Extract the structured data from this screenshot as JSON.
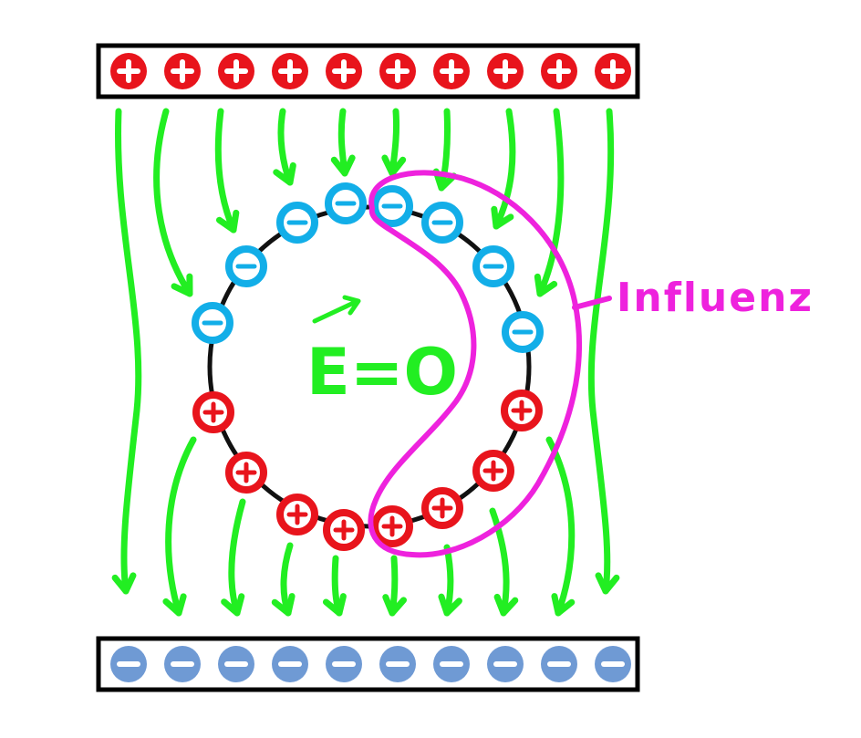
{
  "colors": {
    "field_lines": "#22ee22",
    "positive": "#e8141c",
    "negative_plate": "#6f9ad4",
    "induced_negative": "#12aee8",
    "sphere": "#111111",
    "annotation": "#ee22dd",
    "background": "#ffffff"
  },
  "top_plate": {
    "charge_sign": "positive",
    "charge_count": 10
  },
  "bottom_plate": {
    "charge_sign": "negative",
    "charge_count": 10
  },
  "sphere": {
    "induced_negative_count": 9,
    "induced_positive_count": 8
  },
  "labels": {
    "field_inside": "E=O",
    "annotation": "Influenz"
  },
  "icons": {
    "positive_charge": "plus-circle-icon",
    "negative_charge": "minus-circle-icon",
    "field_arrow": "arrow-down-icon",
    "vector_arrow": "vector-arrow-icon"
  }
}
